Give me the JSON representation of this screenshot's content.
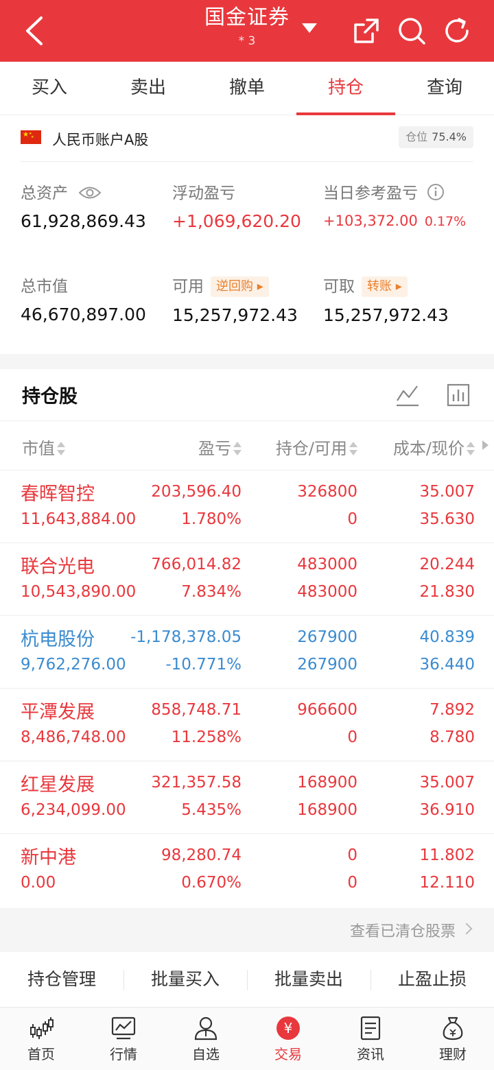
{
  "header": {
    "title": "国金证券",
    "account": "*     3",
    "icons": [
      "back-arrow-icon",
      "dropdown-caret-icon",
      "share-icon",
      "search-icon",
      "refresh-icon"
    ]
  },
  "tabs": [
    {
      "label": "买入"
    },
    {
      "label": "卖出"
    },
    {
      "label": "撤单"
    },
    {
      "label": "持仓",
      "active": true
    },
    {
      "label": "查询"
    }
  ],
  "account": {
    "name": "人民币账户A股",
    "position_label": "仓位",
    "position_value": "75.4%"
  },
  "metrics": {
    "total_assets_label": "总资产",
    "total_assets": "61,928,869.43",
    "float_pl_label": "浮动盈亏",
    "float_pl": "+1,069,620.20",
    "daily_pl_label": "当日参考盈亏",
    "daily_pl": "+103,372.00",
    "daily_pl_pct": "0.17%",
    "market_value_label": "总市值",
    "market_value": "46,670,897.00",
    "available_label": "可用",
    "available_tag": "逆回购",
    "available": "15,257,972.43",
    "withdrawable_label": "可取",
    "withdrawable_tag": "转账",
    "withdrawable": "15,257,972.43"
  },
  "holdings": {
    "title": "持仓股",
    "columns": [
      "市值",
      "盈亏",
      "持仓/可用",
      "成本/现价"
    ],
    "rows": [
      {
        "name": "春晖智控",
        "market_value": "11,643,884.00",
        "pl": "203,596.40",
        "pl_pct": "1.780%",
        "holding": "326800",
        "available": "0",
        "cost": "35.007",
        "price": "35.630",
        "color": "#e8383d"
      },
      {
        "name": "联合光电",
        "market_value": "10,543,890.00",
        "pl": "766,014.82",
        "pl_pct": "7.834%",
        "holding": "483000",
        "available": "483000",
        "cost": "20.244",
        "price": "21.830",
        "color": "#e8383d"
      },
      {
        "name": "杭电股份",
        "market_value": "9,762,276.00",
        "pl": "-1,178,378.05",
        "pl_pct": "-10.771%",
        "holding": "267900",
        "available": "267900",
        "cost": "40.839",
        "price": "36.440",
        "color": "#3b8bd0"
      },
      {
        "name": "平潭发展",
        "market_value": "8,486,748.00",
        "pl": "858,748.71",
        "pl_pct": "11.258%",
        "holding": "966600",
        "available": "0",
        "cost": "7.892",
        "price": "8.780",
        "color": "#e8383d"
      },
      {
        "name": "红星发展",
        "market_value": "6,234,099.00",
        "pl": "321,357.58",
        "pl_pct": "5.435%",
        "holding": "168900",
        "available": "168900",
        "cost": "35.007",
        "price": "36.910",
        "color": "#e8383d"
      },
      {
        "name": "新中港",
        "market_value": "0.00",
        "pl": "98,280.74",
        "pl_pct": "0.670%",
        "holding": "0",
        "available": "0",
        "cost": "11.802",
        "price": "12.110",
        "color": "#e8383d"
      }
    ],
    "cleared_link": "查看已清仓股票"
  },
  "actions": [
    "持仓管理",
    "批量买入",
    "批量卖出",
    "止盈止损"
  ],
  "bottom_nav": [
    {
      "label": "首页",
      "icon": "candlestick-icon"
    },
    {
      "label": "行情",
      "icon": "market-chart-icon"
    },
    {
      "label": "自选",
      "icon": "user-icon"
    },
    {
      "label": "交易",
      "icon": "yuan-coin-icon",
      "active": true
    },
    {
      "label": "资讯",
      "icon": "document-icon"
    },
    {
      "label": "理财",
      "icon": "money-bag-icon"
    }
  ],
  "colors": {
    "brand": "#e8383d",
    "loss": "#3b8bd0"
  }
}
